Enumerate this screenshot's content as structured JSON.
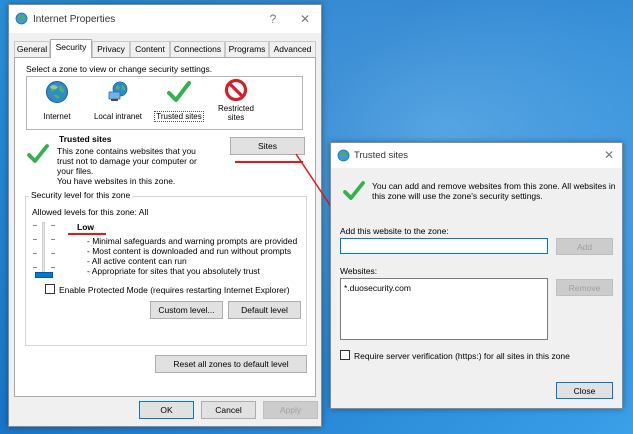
{
  "main_window": {
    "title": "Internet Properties",
    "help_glyph": "?",
    "close_glyph": "✕",
    "tabs": [
      {
        "label": "General"
      },
      {
        "label": "Security"
      },
      {
        "label": "Privacy"
      },
      {
        "label": "Content"
      },
      {
        "label": "Connections"
      },
      {
        "label": "Programs"
      },
      {
        "label": "Advanced"
      }
    ],
    "active_tab": "Security",
    "zone_prompt": "Select a zone to view or change security settings.",
    "zones": [
      {
        "label": "Internet",
        "icon": "globe-icon"
      },
      {
        "label": "Local intranet",
        "icon": "network-icon"
      },
      {
        "label": "Trusted sites",
        "icon": "checkmark-icon"
      },
      {
        "label": "Restricted sites",
        "icon": "no-entry-icon"
      }
    ],
    "selected_zone": "Trusted sites",
    "zone_info": {
      "title": "Trusted sites",
      "lines": [
        "This zone contains websites that you",
        "trust not to damage your computer or",
        "your files.",
        "You have websites in this zone."
      ]
    },
    "sites_button": "Sites",
    "security_level": {
      "group_title": "Security level for this zone",
      "allowed": "Allowed levels for this zone: All",
      "level_name": "Low",
      "slider_level": "Low (lowest of 5 positions)",
      "bullets": [
        "- Minimal safeguards and warning prompts are provided",
        "- Most content is downloaded and run without prompts",
        "- All active content can run",
        "- Appropriate for sites that you absolutely trust"
      ]
    },
    "protected_mode": {
      "label": "Enable Protected Mode (requires restarting Internet Explorer)",
      "checked": false
    },
    "custom_level_button": "Custom level...",
    "default_level_button": "Default level",
    "reset_all_button": "Reset all zones to default level",
    "ok_button": "OK",
    "cancel_button": "Cancel",
    "apply_button": "Apply"
  },
  "trusted_dialog": {
    "title": "Trusted sites",
    "close_glyph": "✕",
    "info_line1": "You can add and remove websites from this zone. All websites in",
    "info_line2": "this zone will use the zone's security settings.",
    "add_label": "Add this website to the zone:",
    "add_value": "",
    "add_button": "Add",
    "websites_label": "Websites:",
    "websites": [
      "*.duosecurity.com"
    ],
    "remove_button": "Remove",
    "require_verification": {
      "label": "Require server verification (https:) for all sites in this zone",
      "checked": false
    },
    "close_button": "Close"
  },
  "colors": {
    "annotation_red": "#e0191d",
    "accent_blue": "#0078d7",
    "check_green": "#2fb34a"
  }
}
